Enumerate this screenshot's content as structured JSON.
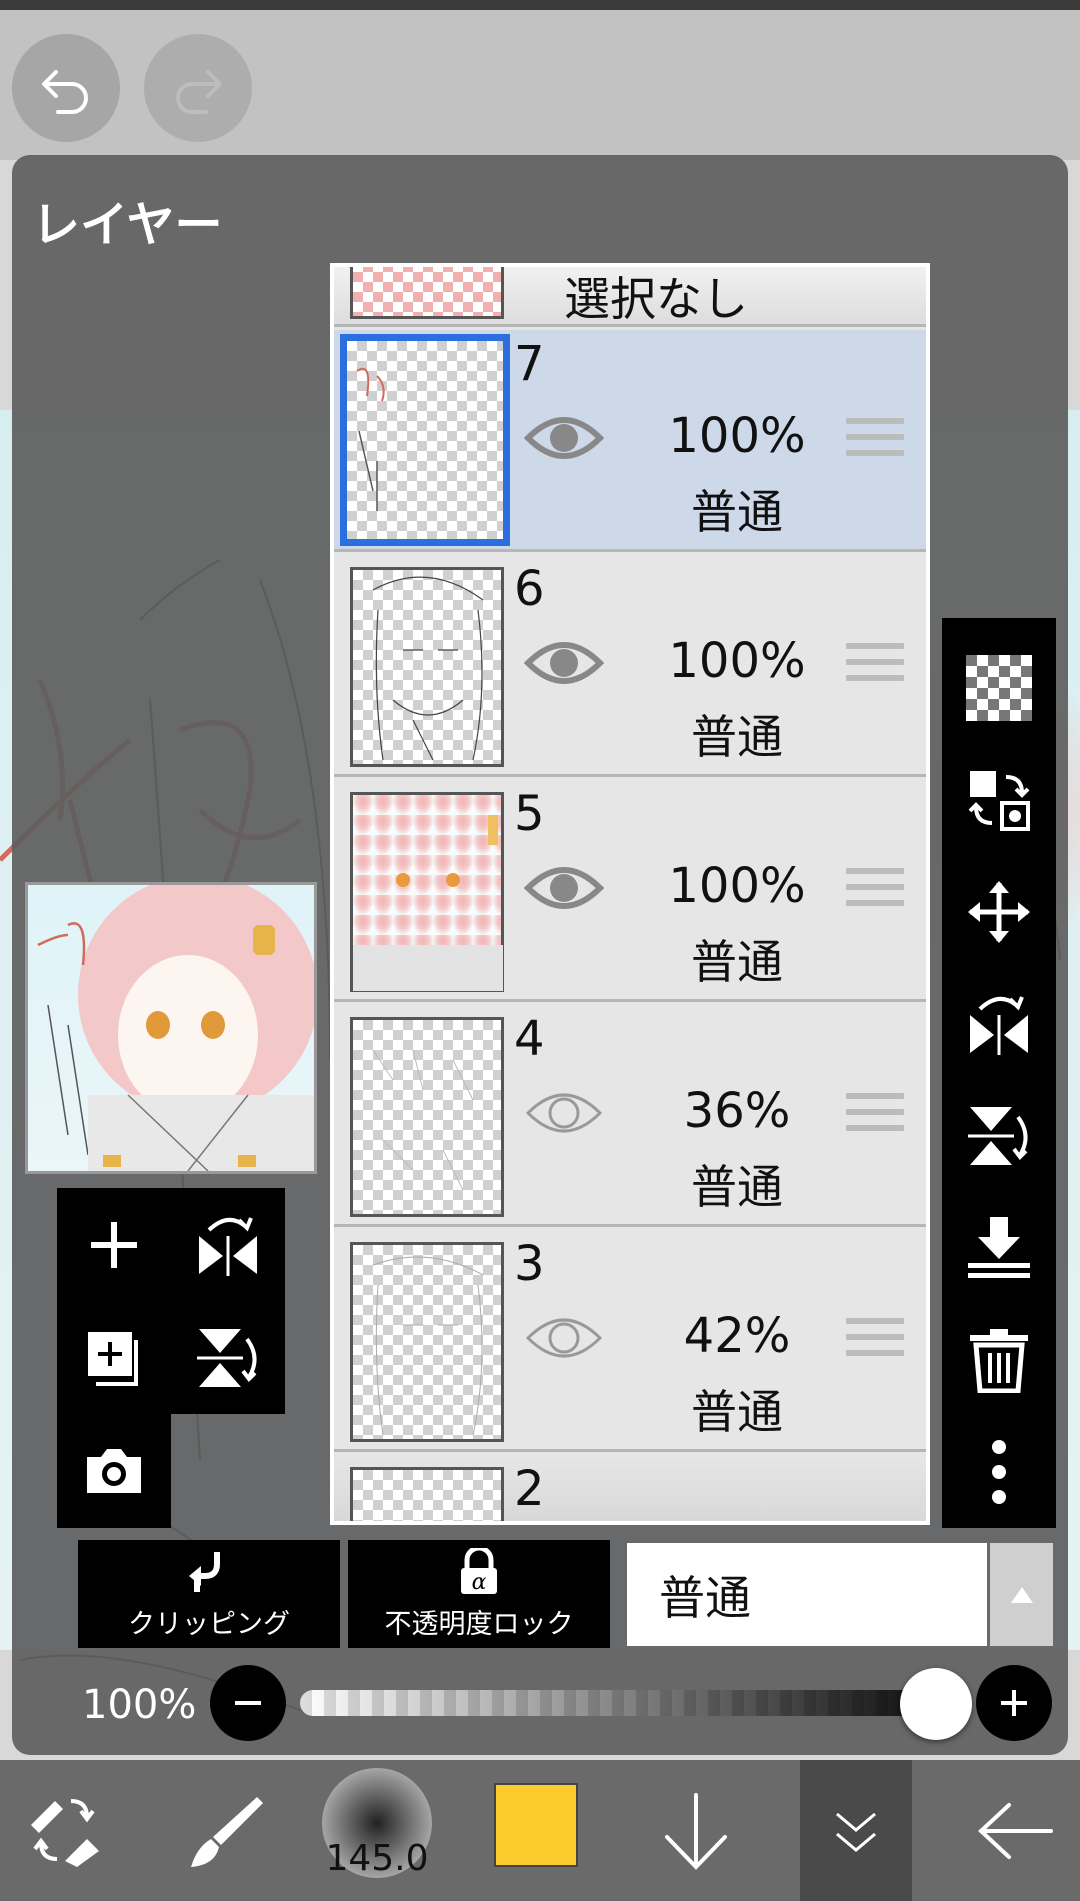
{
  "topbar": {
    "undo_icon": "undo-icon",
    "redo_icon": "redo-icon"
  },
  "panel": {
    "title": "レイヤー"
  },
  "layers": {
    "none_row": {
      "label": "選択なし"
    },
    "items": [
      {
        "num": "7",
        "opacity": "100%",
        "mode": "普通",
        "visible": true,
        "selected": true
      },
      {
        "num": "6",
        "opacity": "100%",
        "mode": "普通",
        "visible": true,
        "selected": false
      },
      {
        "num": "5",
        "opacity": "100%",
        "mode": "普通",
        "visible": true,
        "selected": false
      },
      {
        "num": "4",
        "opacity": "36%",
        "mode": "普通",
        "visible": false,
        "selected": false
      },
      {
        "num": "3",
        "opacity": "42%",
        "mode": "普通",
        "visible": false,
        "selected": false
      },
      {
        "num": "2"
      }
    ]
  },
  "right_toolbar": [
    "transparent-fill-icon",
    "layer-swap-icon",
    "move-icon",
    "flip-horizontal-icon",
    "flip-vertical-icon",
    "merge-down-icon",
    "trash-icon",
    "more-vert-icon"
  ],
  "left_toolbar": [
    "add-layer-icon",
    "flip-horizontal-icon",
    "add-layer-copy-icon",
    "flip-vertical-icon",
    "camera-icon"
  ],
  "controls": {
    "clipping_label": "クリッピング",
    "alpha_lock_label": "不透明度ロック",
    "blend_mode": "普通",
    "opacity_label": "100%",
    "opacity_value": 1.0
  },
  "bottom_nav": {
    "brush_size": "145.0",
    "color": "#fccc2e"
  }
}
